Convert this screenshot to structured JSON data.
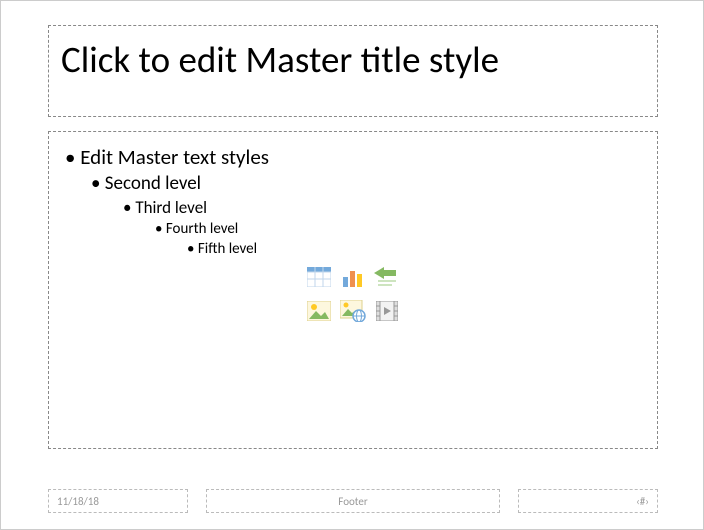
{
  "title": "Click to edit Master title style",
  "bullets": {
    "l1": "Edit Master text styles",
    "l2": "Second level",
    "l3": "Third level",
    "l4": "Fourth level",
    "l5": "Fifth level"
  },
  "insert_icons": {
    "table": "insert-table",
    "chart": "insert-chart",
    "smartart": "insert-smartart",
    "picture": "insert-picture",
    "online_picture": "insert-online-picture",
    "video": "insert-video"
  },
  "footer": {
    "date": "11/18/18",
    "center": "Footer",
    "number": "‹#›"
  }
}
